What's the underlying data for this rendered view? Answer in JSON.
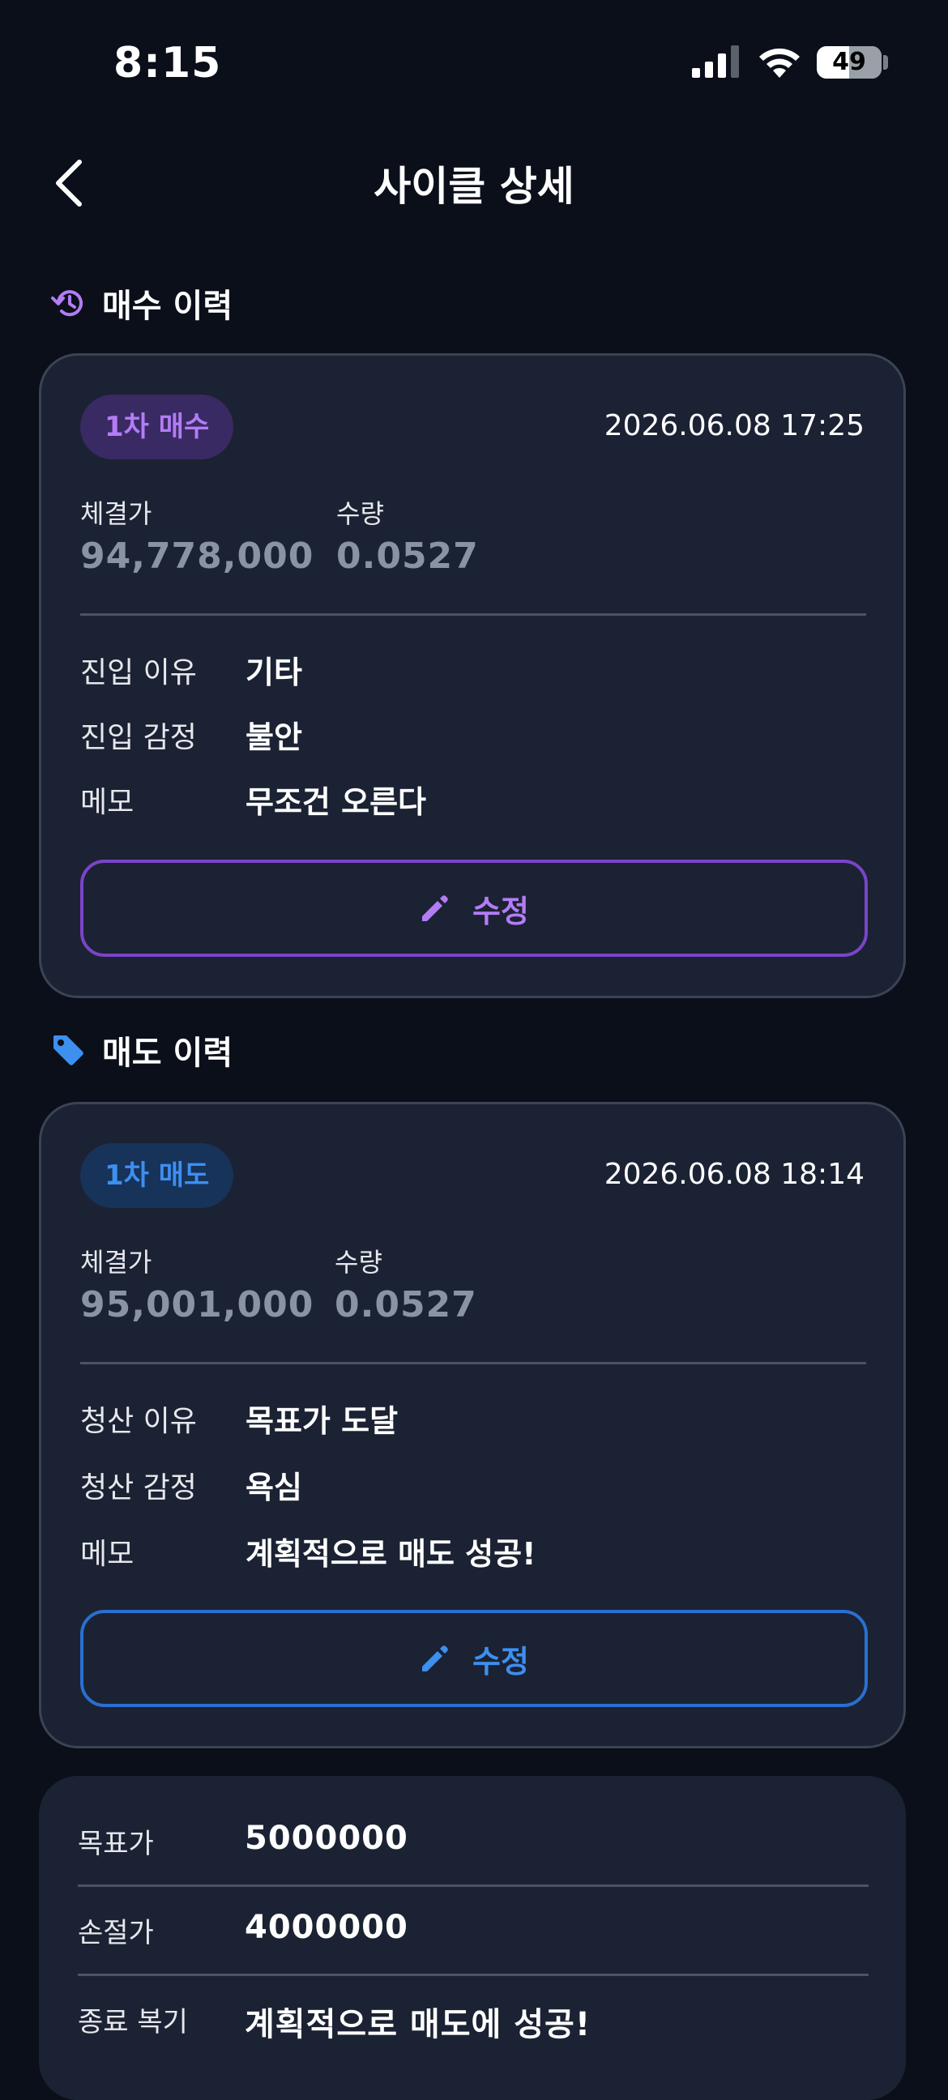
{
  "status_bar": {
    "time": "8:15",
    "battery_level": "49",
    "icons": [
      "signal-icon",
      "wifi-icon",
      "battery-icon"
    ]
  },
  "nav": {
    "back_icon": "chevron-left-icon",
    "title": "사이클 상세"
  },
  "buy_section": {
    "icon": "history-icon",
    "title": "매수 이력",
    "accent": "#b37cf5",
    "card": {
      "chip": "1차 매수",
      "datetime": "2026.06.08 17:25",
      "price_label": "체결가",
      "price_value": "94,778,000",
      "qty_label": "수량",
      "qty_value": "0.0527",
      "rows": [
        {
          "label": "진입 이유",
          "value": "기타"
        },
        {
          "label": "진입 감정",
          "value": "불안"
        },
        {
          "label": "메모",
          "value": "무조건 오른다"
        }
      ],
      "edit_label": "수정",
      "edit_icon": "pencil-icon"
    }
  },
  "sell_section": {
    "icon": "tag-icon",
    "title": "매도 이력",
    "accent": "#3d8ff0",
    "card": {
      "chip": "1차 매도",
      "datetime": "2026.06.08 18:14",
      "price_label": "체결가",
      "price_value": "95,001,000",
      "qty_label": "수량",
      "qty_value": "0.0527",
      "rows": [
        {
          "label": "청산 이유",
          "value": "목표가 도달"
        },
        {
          "label": "청산 감정",
          "value": "욕심"
        },
        {
          "label": "메모",
          "value": "계획적으로 매도 성공!"
        }
      ],
      "edit_label": "수정",
      "edit_icon": "pencil-icon"
    }
  },
  "summary": {
    "rows": [
      {
        "label": "목표가",
        "value": "5000000"
      },
      {
        "label": "손절가",
        "value": "4000000"
      },
      {
        "label": "종료 복기",
        "value": "계획적으로 매도에 성공!"
      }
    ]
  },
  "colors": {
    "background": "#0a0f1a",
    "card": "#1b2233",
    "buy_accent": "#b37cf5",
    "sell_accent": "#3d8ff0"
  }
}
